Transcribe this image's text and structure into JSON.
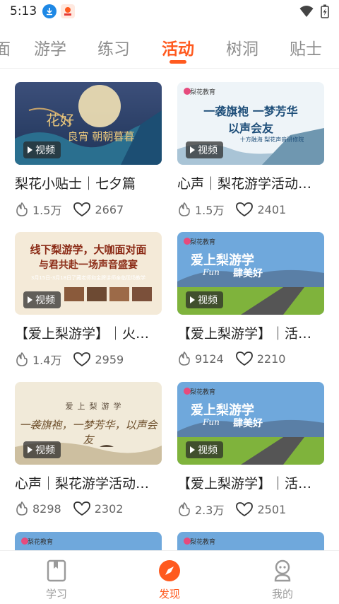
{
  "status_bar": {
    "time": "5:13",
    "icons": [
      "download-icon",
      "app-badge-icon",
      "wifi-icon",
      "battery-icon"
    ]
  },
  "tabs": [
    {
      "label": "面",
      "active": false
    },
    {
      "label": "游学",
      "active": false
    },
    {
      "label": "练习",
      "active": false
    },
    {
      "label": "活动",
      "active": true
    },
    {
      "label": "树洞",
      "active": false
    },
    {
      "label": "贴士",
      "active": false
    }
  ],
  "colors": {
    "accent": "#ff5a1f",
    "inactive_tab": "#8e8e8e",
    "text": "#222222",
    "meta": "#666666"
  },
  "cards": [
    {
      "thumb_text": [
        "花好",
        "良宵 朝朝暮暮"
      ],
      "brand": "",
      "badge": "视频",
      "title": "梨花小贴士｜七夕篇",
      "views": "1.5万",
      "likes": "2667"
    },
    {
      "thumb_text": [
        "一袭旗袍 一梦芳华",
        "以声会友",
        "十方融海 梨花声音研修院"
      ],
      "brand": "梨花教育",
      "badge": "视频",
      "title": "心声｜梨花游学活动…",
      "views": "1.5万",
      "likes": "2401"
    },
    {
      "thumb_text": [
        "线下梨游学，大咖面对面",
        "与君共赴一场声音盛宴",
        "3月15日-3月18日了藏老师和金牌讲师亲临现场教学"
      ],
      "brand": "",
      "badge": "视频",
      "title": "【爱上梨游学】｜火…",
      "views": "1.4万",
      "likes": "2959"
    },
    {
      "thumb_text": [
        "爱上梨游学",
        "Fun",
        "肆美好"
      ],
      "brand": "梨花教育",
      "badge": "视频",
      "title": "【爱上梨游学】｜活…",
      "views": "9124",
      "likes": "2210"
    },
    {
      "thumb_text": [
        "爱上梨游学",
        "一袭旗袍，一梦芳华，以声会友"
      ],
      "brand": "",
      "badge": "视频",
      "title": "心声｜梨花游学活动…",
      "views": "8298",
      "likes": "2302"
    },
    {
      "thumb_text": [
        "爱上梨游学",
        "Fun",
        "肆美好"
      ],
      "brand": "梨花教育",
      "badge": "视频",
      "title": "【爱上梨游学】｜活…",
      "views": "2.3万",
      "likes": "2501"
    },
    {
      "thumb_text": [],
      "brand": "梨花教育",
      "badge": "",
      "title": "",
      "views": "",
      "likes": ""
    },
    {
      "thumb_text": [],
      "brand": "梨花教育",
      "badge": "",
      "title": "",
      "views": "",
      "likes": ""
    }
  ],
  "bottom_nav": [
    {
      "label": "学习",
      "icon": "book-icon",
      "active": false
    },
    {
      "label": "发现",
      "icon": "compass-icon",
      "active": true
    },
    {
      "label": "我的",
      "icon": "profile-icon",
      "active": false
    }
  ]
}
